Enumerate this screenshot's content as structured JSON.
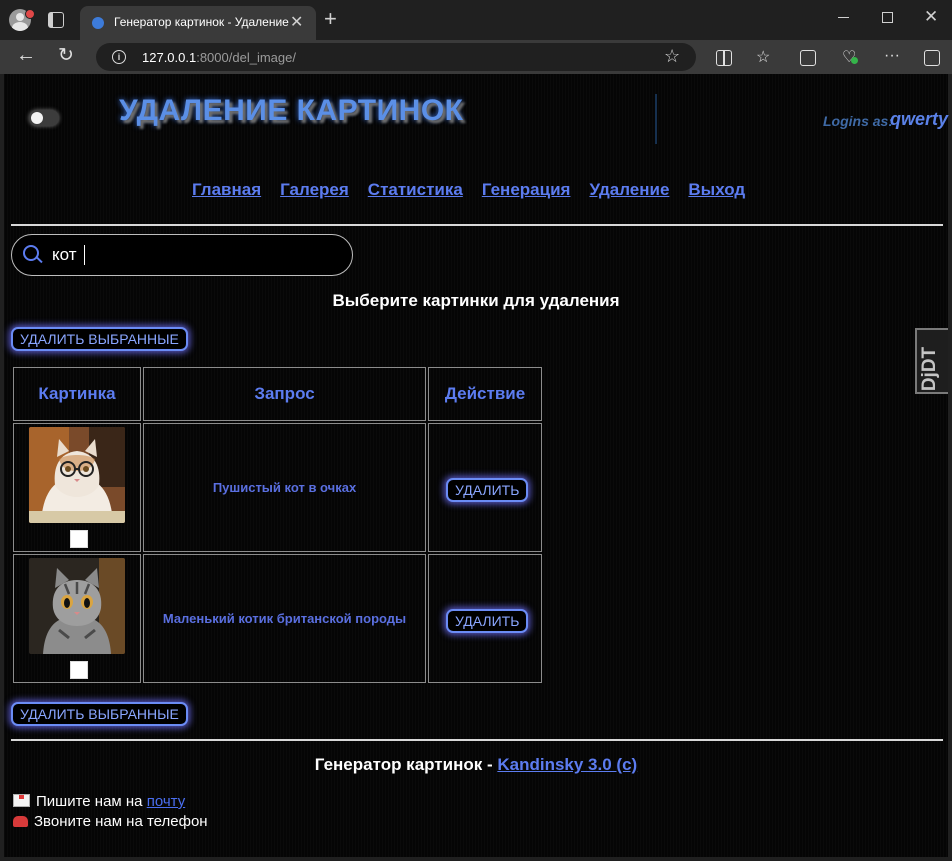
{
  "browser": {
    "tab_title": "Генератор картинок - Удаление",
    "tab_close": "✕",
    "new_tab": "+",
    "url_host": "127.0.0.1",
    "url_rest": ":8000/del_image/",
    "back": "←",
    "reload": "↻",
    "star": "☆",
    "more": "···",
    "win_close": "✕"
  },
  "header": {
    "title": "УДАЛЕНИЕ КАРТИНОК",
    "login_label": "Logins as:",
    "username": "qwerty"
  },
  "menu": [
    "Главная",
    "Галерея",
    "Статистика",
    "Генерация",
    "Удаление",
    "Выход"
  ],
  "search": {
    "value": "кот"
  },
  "subtitle": "Выберите картинки для удаления",
  "delete_selected_label": "УДАЛИТЬ ВЫБРАННЫЕ",
  "table": {
    "headers": [
      "Картинка",
      "Запрос",
      "Действие"
    ],
    "rows": [
      {
        "prompt": "Пушистый кот в очках",
        "action": "УДАЛИТЬ"
      },
      {
        "prompt": "Маленький котик британской породы",
        "action": "УДАЛИТЬ"
      }
    ]
  },
  "footer": {
    "title_prefix": "Генератор картинок -",
    "title_link": "Kandinsky 3.0 (c)",
    "mail_text": "Пишите нам на",
    "mail_link": "почту",
    "phone_text": "Звоните нам на телефон"
  },
  "side_badge": "DjDT",
  "colors": {
    "accent": "#5c7cf0",
    "background": "#050505",
    "button_glow": "#7070ff"
  },
  "icons": [
    "search-icon",
    "mail-icon",
    "phone-icon",
    "star-icon",
    "reload-icon",
    "back-icon"
  ]
}
